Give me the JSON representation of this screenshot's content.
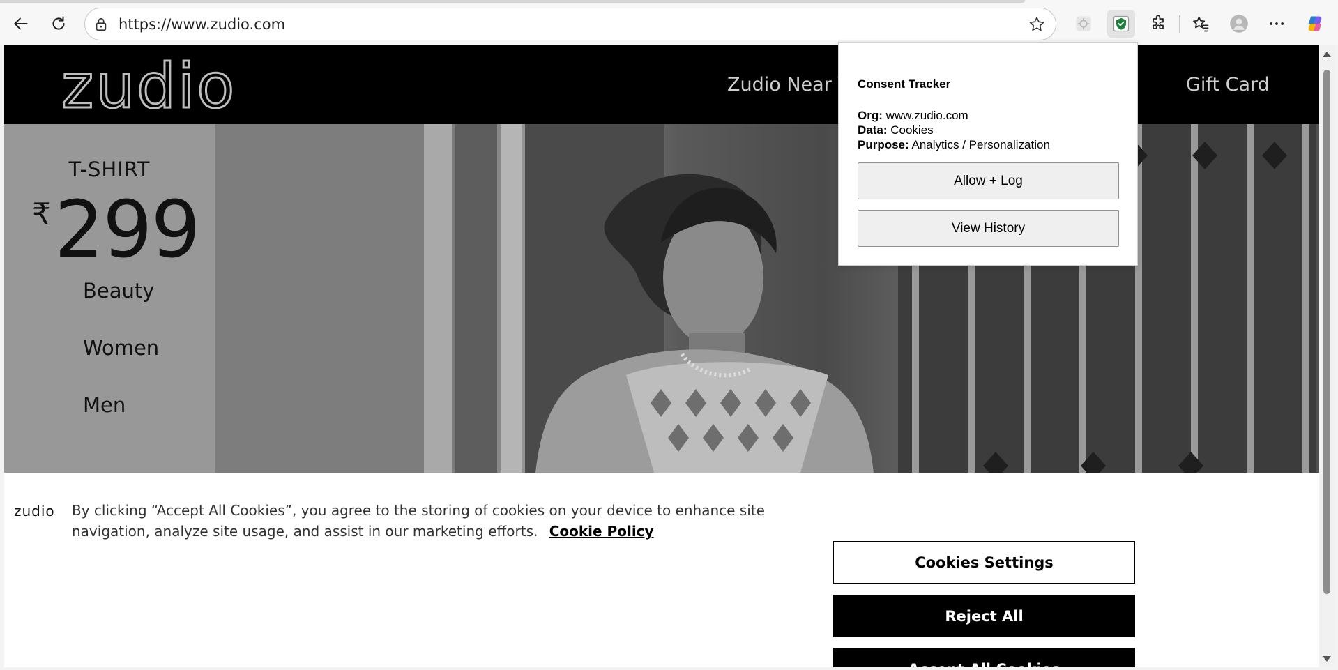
{
  "browser": {
    "url": "https://www.zudio.com",
    "icons": {
      "back": "back-arrow-icon",
      "refresh": "refresh-icon",
      "lock": "lock-icon",
      "favorite": "star-icon",
      "extension_gear": "gear-icon",
      "extension_shield": "shield-icon",
      "extensions": "puzzle-icon",
      "favorites": "favorites-icon",
      "profile": "profile-icon",
      "more": "more-icon",
      "copilot": "copilot-icon"
    }
  },
  "site": {
    "logo": "zudio",
    "nav": {
      "near_you": "Zudio Near Yo",
      "gift_card": "Gift Card"
    },
    "promo": {
      "label": "T-SHIRT",
      "currency": "₹",
      "price": "299"
    },
    "categories": [
      "Beauty",
      "Women",
      "Men"
    ]
  },
  "cookie_banner": {
    "logo": "zudio",
    "text": "By clicking “Accept All Cookies”, you agree to the storing of cookies on your device to enhance site navigation, analyze site usage, and assist in our marketing efforts.",
    "policy_link": "Cookie Policy",
    "buttons": {
      "settings": "Cookies Settings",
      "reject": "Reject All",
      "accept": "Accept All Cookies"
    }
  },
  "popup": {
    "title": "Consent Tracker",
    "org_label": "Org:",
    "org_value": "www.zudio.com",
    "data_label": "Data:",
    "data_value": "Cookies",
    "purpose_label": "Purpose:",
    "purpose_value": "Analytics / Personalization",
    "allow_button": "Allow + Log",
    "history_button": "View History"
  },
  "colors": {
    "site_header": "#000000",
    "left_panel": "#989898",
    "accent_shield": "#1a7f37"
  }
}
